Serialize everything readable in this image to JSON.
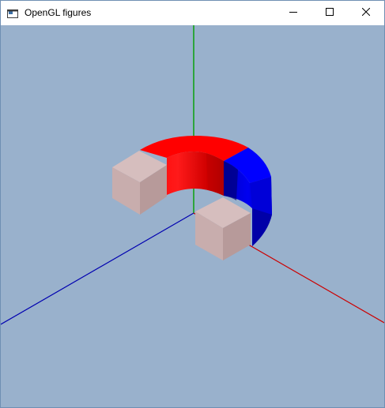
{
  "window": {
    "title": "OpenGL figures",
    "app_icon": "window-app-icon",
    "controls": [
      "minimize-icon",
      "maximize-icon",
      "close-icon"
    ]
  },
  "scene": {
    "background_color": "#99b1cc",
    "axes": {
      "x_color": "#cc0000",
      "y_color": "#00a000",
      "z_color": "#0000b0"
    },
    "magnet": {
      "north_color": "#ff0000",
      "south_color": "#0000ff",
      "pole_cube_color": "#c9aeae"
    }
  }
}
